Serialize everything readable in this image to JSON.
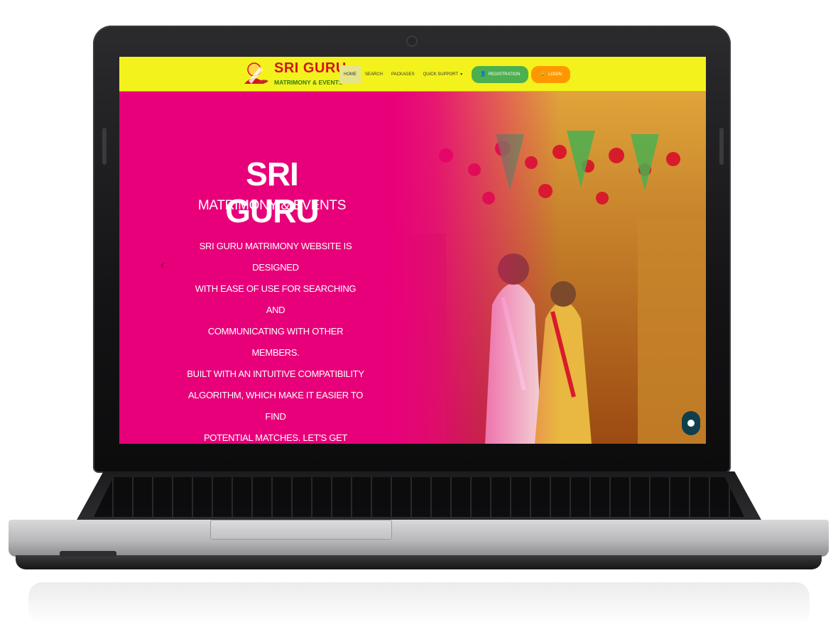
{
  "header": {
    "logo_title": "SRI GURU",
    "logo_subtitle": "MATRIMONY & EVENTS",
    "nav": [
      {
        "label": "HOME"
      },
      {
        "label": "SEARCH"
      },
      {
        "label": "PACKAGES"
      },
      {
        "label": "QUICK SUPPORT"
      }
    ],
    "registration_label": "REGISTRATION",
    "login_label": "LOGIN"
  },
  "hero": {
    "title": "SRI GURU",
    "subtitle": "MATRIMONY & EVENTS",
    "description_lines": [
      "SRI GURU MATRIMONY WEBSITE IS DESIGNED",
      "WITH EASE OF USE FOR SEARCHING AND",
      "COMMUNICATING WITH OTHER MEMBERS.",
      "BUILT WITH AN INTUITIVE COMPATIBILITY",
      "ALGORITHM, WHICH MAKE IT EASIER TO FIND",
      "POTENTIAL MATCHES.  LET'S GET STARTED..."
    ],
    "prev_arrow": "‹"
  },
  "colors": {
    "header_bg": "#f3f21c",
    "hero_bg": "#e8007a",
    "registration_btn": "#4caf50",
    "login_btn": "#ff9800",
    "logo_title": "#d4151b",
    "logo_subtitle": "#2e7d1a"
  },
  "icons": {
    "registration": "user-plus-icon",
    "login": "lock-icon",
    "chat": "chat-bubble-icon",
    "quick_support": "caret-down-icon"
  }
}
